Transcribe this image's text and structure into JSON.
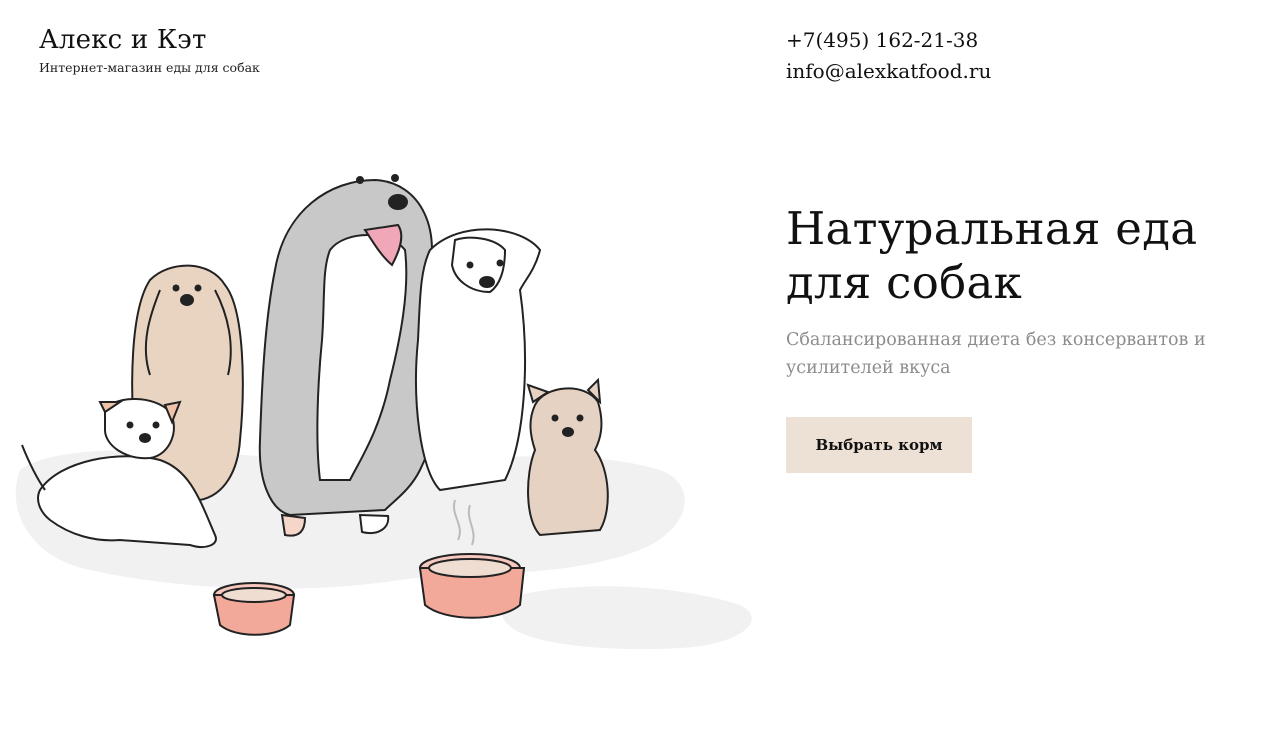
{
  "brand": {
    "name": "Алекс и Кэт",
    "tagline": "Интернет-магазин еды для собак"
  },
  "contacts": {
    "phone": "+7(495) 162-21-38",
    "email": "info@alexkatfood.ru"
  },
  "hero": {
    "title_line1": "Натуральная еда",
    "title_line2": "для собак",
    "subtitle": "Сбалансированная диета без консервантов и усилителей вкуса",
    "cta_label": "Выбрать корм"
  },
  "colors": {
    "cta_background": "#ede1d6",
    "subtitle_text": "#8c8c8c",
    "bowl": "#f2a99a",
    "ground_shadow": "#efefef"
  },
  "illustration": {
    "subject": "dogs-with-food-bowls-illustration"
  }
}
